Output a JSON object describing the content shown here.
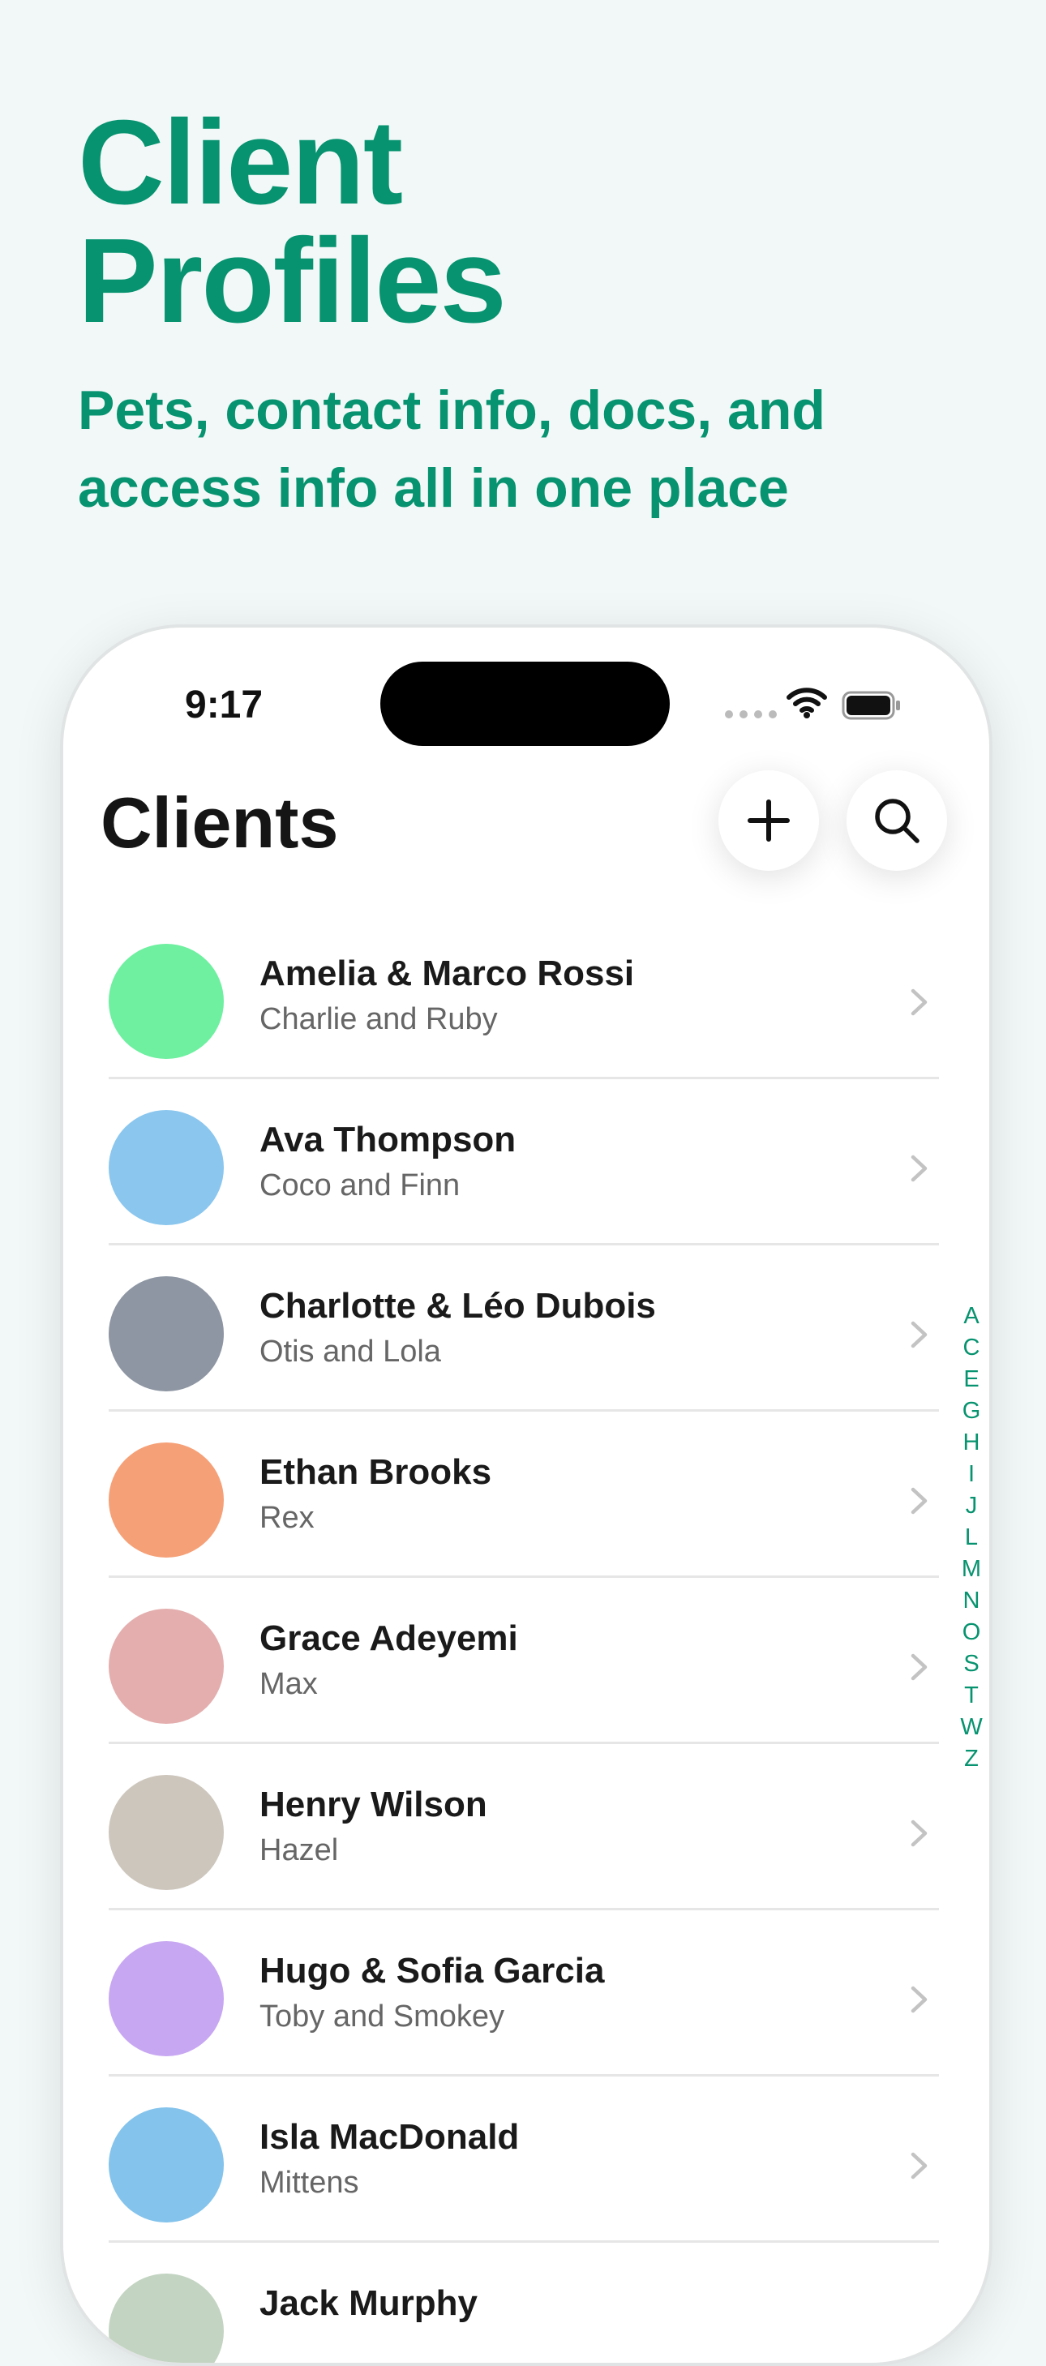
{
  "hero": {
    "title_line1": "Client",
    "title_line2": "Profiles",
    "subtitle_line1": "Pets, contact info, docs, and",
    "subtitle_line2": "access info all in one place"
  },
  "status_bar": {
    "time": "9:17"
  },
  "screen": {
    "title": "Clients",
    "add_icon": "plus-icon",
    "search_icon": "search-icon"
  },
  "clients": [
    {
      "name": "Amelia & Marco Rossi",
      "pets": "Charlie and Ruby",
      "avatar_bg": "#6ef0a0"
    },
    {
      "name": "Ava Thompson",
      "pets": "Coco and Finn",
      "avatar_bg": "#8ac6ee"
    },
    {
      "name": "Charlotte & Léo Dubois",
      "pets": "Otis and Lola",
      "avatar_bg": "#8e96a3"
    },
    {
      "name": "Ethan Brooks",
      "pets": "Rex",
      "avatar_bg": "#f5a077"
    },
    {
      "name": "Grace Adeyemi",
      "pets": "Max",
      "avatar_bg": "#e4aeae"
    },
    {
      "name": "Henry Wilson",
      "pets": "Hazel",
      "avatar_bg": "#cdc6bd"
    },
    {
      "name": "Hugo & Sofia Garcia",
      "pets": "Toby and Smokey",
      "avatar_bg": "#c7a7f2"
    },
    {
      "name": "Isla MacDonald",
      "pets": "Mittens",
      "avatar_bg": "#84c3ec"
    },
    {
      "name": "Jack Murphy",
      "pets": "",
      "avatar_bg": "#c3d4c2"
    }
  ],
  "index_letters": [
    "A",
    "C",
    "E",
    "G",
    "H",
    "I",
    "J",
    "L",
    "M",
    "N",
    "O",
    "S",
    "T",
    "W",
    "Z"
  ],
  "colors": {
    "accent": "#07936f",
    "background": "#f2f8f8"
  }
}
